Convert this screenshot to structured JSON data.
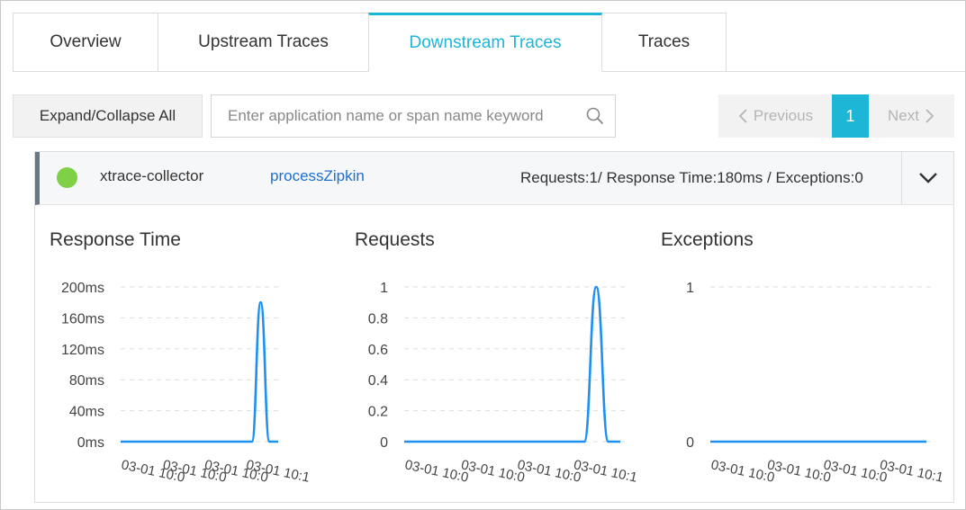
{
  "tabs": [
    {
      "label": "Overview",
      "active": false
    },
    {
      "label": "Upstream Traces",
      "active": false
    },
    {
      "label": "Downstream Traces",
      "active": true
    },
    {
      "label": "Traces",
      "active": false
    }
  ],
  "toolbar": {
    "expand_label": "Expand/Collapse All",
    "search_placeholder": "Enter application name or span name keyword",
    "search_value": ""
  },
  "pagination": {
    "previous_label": "Previous",
    "current_page": "1",
    "next_label": "Next"
  },
  "trace_row": {
    "status_color": "#7ed047",
    "app_name": "xtrace-collector",
    "span_name": "processZipkin",
    "summary": "Requests:1/ Response Time:180ms / Exceptions:0"
  },
  "chart_data": [
    {
      "type": "line",
      "title": "Response Time",
      "color": "#1e90f0",
      "y_ticks": [
        "0ms",
        "40ms",
        "80ms",
        "120ms",
        "160ms",
        "200ms"
      ],
      "ylim": [
        0,
        200
      ],
      "x": [
        "03-01",
        "03-01",
        "03-01",
        "03-01",
        "",
        "",
        "",
        "",
        "",
        "",
        "",
        "",
        "",
        "",
        "",
        "",
        "",
        "",
        "",
        "",
        "",
        "",
        ""
      ],
      "x_tick_labels": [
        "03-01 10:0",
        "03-01 10:0",
        "03-01 10:0",
        "03-01 10:1"
      ],
      "values": [
        0,
        0,
        0,
        0,
        0,
        0,
        0,
        0,
        0,
        0,
        0,
        0,
        0,
        0,
        0,
        0,
        180,
        0,
        0
      ],
      "grid": true
    },
    {
      "type": "line",
      "title": "Requests",
      "color": "#1e90f0",
      "y_ticks": [
        "0",
        "0.2",
        "0.4",
        "0.6",
        "0.8",
        "1"
      ],
      "ylim": [
        0,
        1
      ],
      "x_tick_labels": [
        "03-01 10:0",
        "03-01 10:0",
        "03-01 10:0",
        "03-01 10:1"
      ],
      "values": [
        0,
        0,
        0,
        0,
        0,
        0,
        0,
        0,
        0,
        0,
        0,
        0,
        0,
        0,
        0,
        0,
        1,
        0,
        0
      ],
      "grid": true
    },
    {
      "type": "line",
      "title": "Exceptions",
      "color": "#1e90f0",
      "y_ticks": [
        "0",
        "1"
      ],
      "ylim": [
        0,
        1
      ],
      "x_tick_labels": [
        "03-01 10:0",
        "03-01 10:0",
        "03-01 10:0",
        "03-01 10:1"
      ],
      "values": [
        0,
        0,
        0,
        0,
        0,
        0,
        0,
        0,
        0,
        0,
        0,
        0,
        0,
        0,
        0,
        0,
        0,
        0,
        0
      ],
      "grid": true
    }
  ]
}
